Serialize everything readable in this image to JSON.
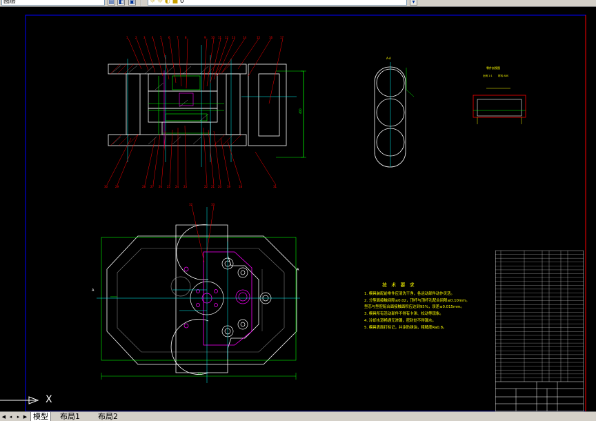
{
  "toolbar": {
    "layer_combo": "图层",
    "style_combo": "",
    "layer_state": "0"
  },
  "layout_tabs": [
    {
      "label": "模型",
      "active": true
    },
    {
      "label": "布局1",
      "active": false
    },
    {
      "label": "布局2",
      "active": false
    }
  ],
  "ucs": {
    "axis_label": "X"
  },
  "technical_requirements": {
    "title": "技 术 要 求",
    "items": [
      "1. 模具装配前零件应清洗干净，各运动部件动作灵活。",
      "2. 分型面接触间隙≤0.02，顶杆与顶杆孔配合间隙≤0.10mm。",
      "   型芯与型腔配合面接触面积应达到95%，误差≤0.015mm。",
      "3. 模具所有活动部件不得有卡滞、松动等现象。",
      "4. 冷却水道畅通无渗漏，密封处不得漏水。",
      "5. 模具表面打标记，并涂防锈油，粗糙度Ra0.8。"
    ]
  },
  "colors": {
    "outline": "#ffffff",
    "hidden": "#00ff00",
    "center": "#00ffff",
    "leader": "#ff0000",
    "part": "#ff00ff",
    "dimension": "#00ff00",
    "annotation": "#ffff00",
    "frame": "#0000ff",
    "frame_inner": "#ff0000"
  }
}
